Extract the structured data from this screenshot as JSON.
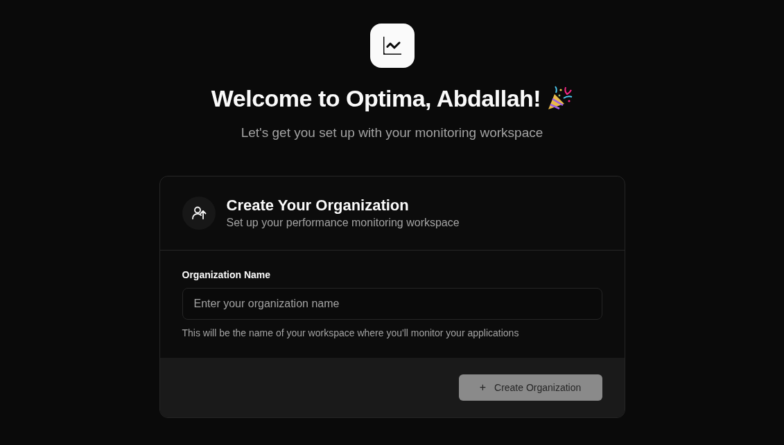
{
  "header": {
    "title": "Welcome to Optima, Abdallah!",
    "subtitle": "Let's get you set up with your monitoring workspace"
  },
  "card": {
    "title": "Create Your Organization",
    "subtitle": "Set up your performance monitoring workspace",
    "field": {
      "label": "Organization Name",
      "placeholder": "Enter your organization name",
      "help": "This will be the name of your workspace where you'll monitor your applications"
    },
    "submit": {
      "icon": "+",
      "label": "Create Organization",
      "disabled": true
    }
  }
}
